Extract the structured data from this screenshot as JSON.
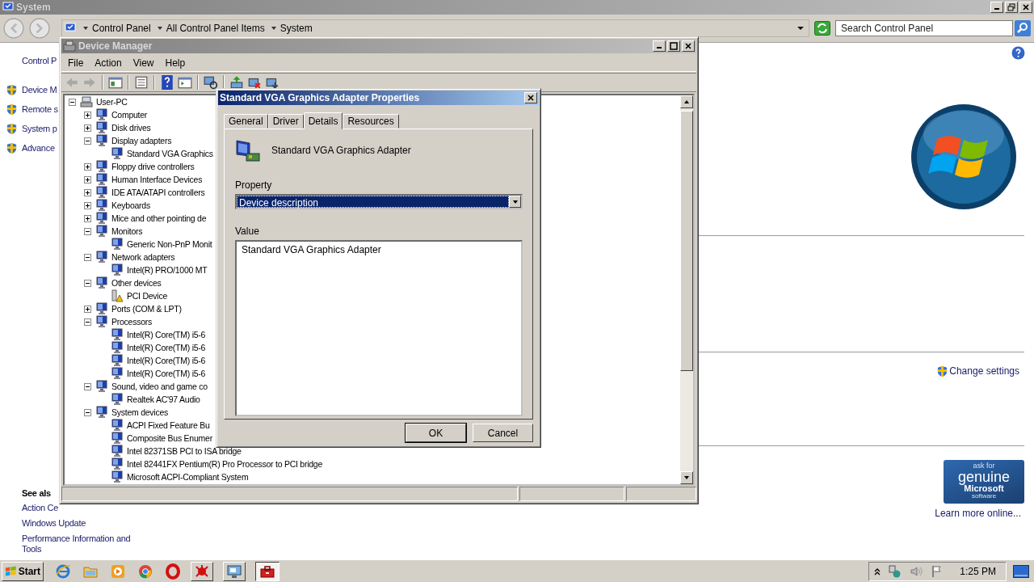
{
  "system_window": {
    "title": "System",
    "breadcrumb": [
      "Control Panel",
      "All Control Panel Items",
      "System"
    ],
    "search": {
      "placeholder": "Search Control Panel"
    },
    "left_pane": {
      "home_link": "Control P",
      "tasks": [
        "Device M",
        "Remote s",
        "System p",
        "Advance"
      ],
      "see_also_heading": "See als",
      "see_also": [
        "Action Ce",
        "Windows Update",
        "Performance Information and Tools"
      ]
    },
    "change_settings": "Change settings",
    "genuine_badge": {
      "line_1": "ask for",
      "line_2": "genuine",
      "line_3": "Microsoft",
      "line_4": "software"
    },
    "learn_more": "Learn more online..."
  },
  "device_manager": {
    "title": "Device Manager",
    "menu": [
      "File",
      "Action",
      "View",
      "Help"
    ],
    "tree": {
      "label": "User-PC",
      "expanded": true,
      "children": [
        {
          "label": "Computer",
          "expanded": false
        },
        {
          "label": "Disk drives",
          "expanded": false
        },
        {
          "label": "Display adapters",
          "expanded": true,
          "children": [
            {
              "label": "Standard VGA Graphics"
            }
          ]
        },
        {
          "label": "Floppy drive controllers",
          "expanded": false
        },
        {
          "label": "Human Interface Devices",
          "expanded": false
        },
        {
          "label": "IDE ATA/ATAPI controllers",
          "expanded": false
        },
        {
          "label": "Keyboards",
          "expanded": false
        },
        {
          "label": "Mice and other pointing de",
          "expanded": false
        },
        {
          "label": "Monitors",
          "expanded": true,
          "children": [
            {
              "label": "Generic Non-PnP Monit"
            }
          ]
        },
        {
          "label": "Network adapters",
          "expanded": true,
          "children": [
            {
              "label": "Intel(R) PRO/1000 MT"
            }
          ]
        },
        {
          "label": "Other devices",
          "expanded": true,
          "children": [
            {
              "label": "PCI Device",
              "problem": true
            }
          ]
        },
        {
          "label": "Ports (COM & LPT)",
          "expanded": false
        },
        {
          "label": "Processors",
          "expanded": true,
          "children": [
            {
              "label": "Intel(R) Core(TM) i5-6"
            },
            {
              "label": "Intel(R) Core(TM) i5-6"
            },
            {
              "label": "Intel(R) Core(TM) i5-6"
            },
            {
              "label": "Intel(R) Core(TM) i5-6"
            }
          ]
        },
        {
          "label": "Sound, video and game co",
          "expanded": true,
          "children": [
            {
              "label": "Realtek AC'97 Audio"
            }
          ]
        },
        {
          "label": "System devices",
          "expanded": true,
          "children": [
            {
              "label": "ACPI Fixed Feature Bu"
            },
            {
              "label": "Composite Bus Enumer"
            },
            {
              "label": "Intel 82371SB PCI to ISA bridge"
            },
            {
              "label": "Intel 82441FX Pentium(R) Pro Processor to PCI bridge"
            },
            {
              "label": "Microsoft ACPI-Compliant System"
            }
          ]
        }
      ]
    }
  },
  "properties_dialog": {
    "title": "Standard VGA Graphics Adapter Properties",
    "tabs": [
      {
        "label": "General",
        "selected": false
      },
      {
        "label": "Driver",
        "selected": false
      },
      {
        "label": "Details",
        "selected": true
      },
      {
        "label": "Resources",
        "selected": false
      }
    ],
    "device_name": "Standard VGA Graphics Adapter",
    "property_label": "Property",
    "property_value": "Device description",
    "value_label": "Value",
    "values": [
      "Standard VGA Graphics Adapter"
    ],
    "buttons": [
      {
        "label": "OK",
        "default": true
      },
      {
        "label": "Cancel",
        "default": false
      }
    ]
  },
  "taskbar": {
    "start": "Start",
    "windows": [
      {
        "selected": false
      },
      {
        "selected": false
      },
      {
        "selected": true
      }
    ],
    "clock": "1:25 PM"
  }
}
